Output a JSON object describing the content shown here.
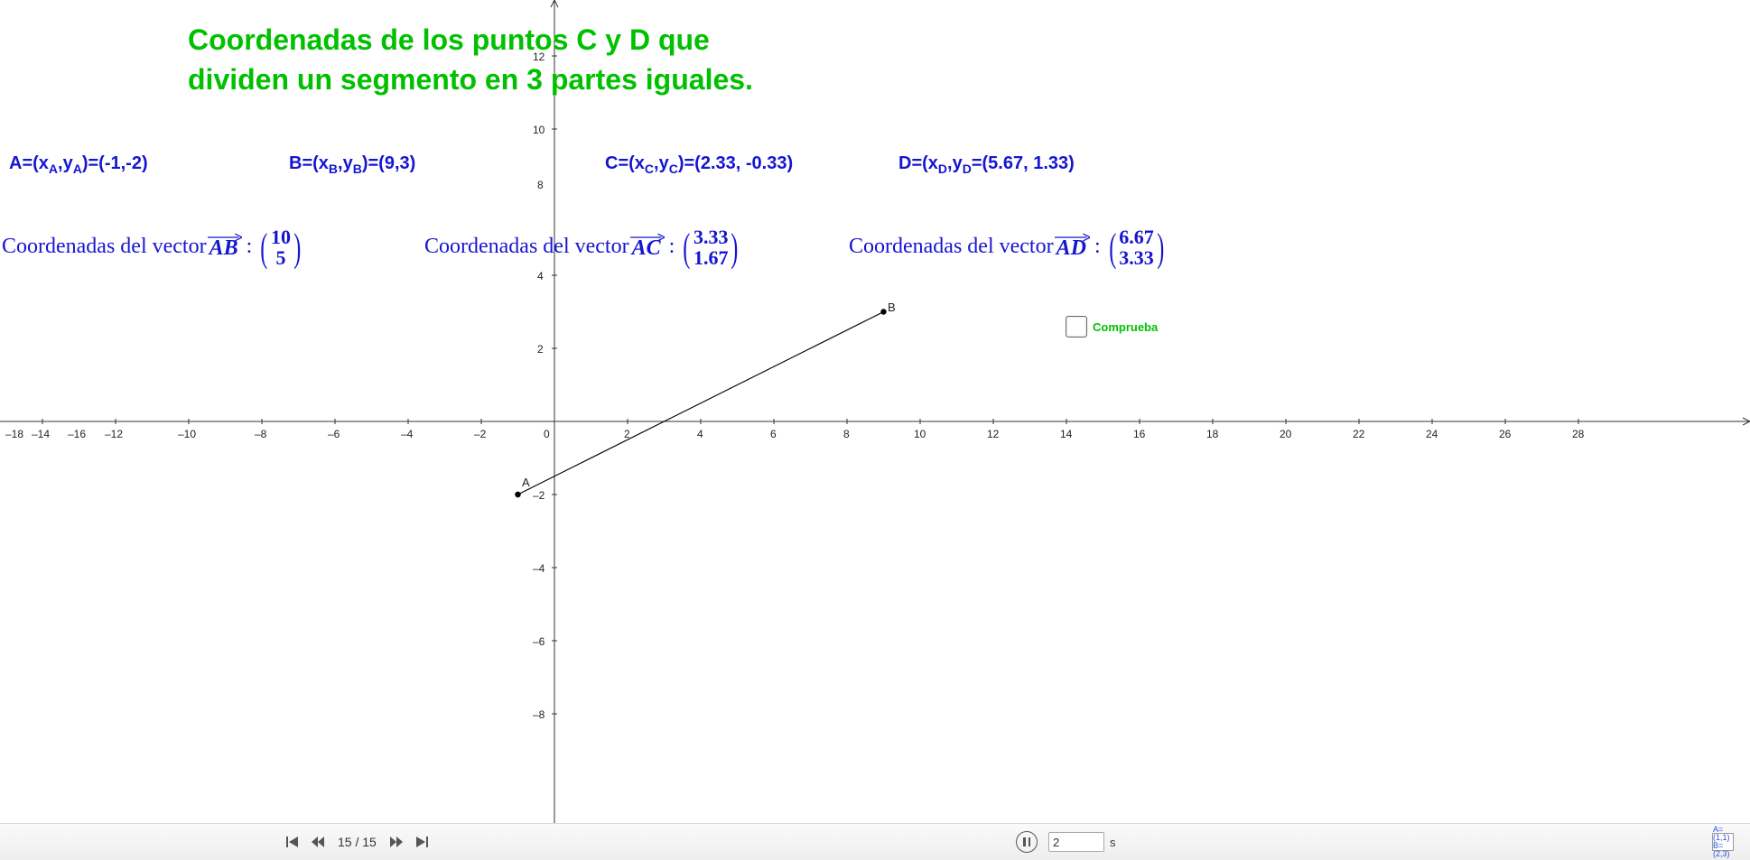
{
  "title_line1": "Coordenadas de los puntos C y D que",
  "title_line2": "dividen un segmento en  3 partes iguales.",
  "points": {
    "A": {
      "sub1": "A",
      "sub2": "A",
      "text": "A=(x",
      "mid": ",y",
      "close": ")=(-1,-2)"
    },
    "B": {
      "sub1": "B",
      "sub2": "B",
      "text": "B=(x",
      "mid": ",y",
      "close": ")=(9,3)"
    },
    "C": {
      "sub1": "C",
      "sub2": "C",
      "text": "C=(x",
      "mid": ",y",
      "close": ")=(2.33, -0.33)"
    },
    "D": {
      "sub1": "D",
      "sub2": "D",
      "text": "D=(x",
      "mid": ",y",
      "close": "=(5.67, 1.33)"
    }
  },
  "vec_prefix": "Coordenadas del vector",
  "vectors": {
    "AB": {
      "name": "AB",
      "x": "10",
      "y": "5"
    },
    "AC": {
      "name": "AC",
      "x": "3.33",
      "y": "1.67"
    },
    "AD": {
      "name": "AD",
      "x": "6.67",
      "y": "3.33"
    }
  },
  "checkbox_label": "Comprueba",
  "toolbar": {
    "counter": "15 / 15",
    "speed_value": "2",
    "speed_unit": "s",
    "aux_top": "A=(1,1)",
    "aux_bot": "B=(2,3)"
  },
  "chart_data": {
    "type": "line",
    "xlabel": "",
    "ylabel": "",
    "xlim": [
      -18,
      28
    ],
    "ylim": [
      -8,
      12
    ],
    "x_ticks": [
      -18,
      -16,
      -14,
      -12,
      -10,
      -8,
      -6,
      -4,
      -2,
      0,
      2,
      4,
      6,
      8,
      10,
      12,
      14,
      16,
      18,
      20,
      22,
      24,
      26,
      28
    ],
    "y_ticks": [
      -8,
      -6,
      -4,
      -2,
      2,
      4,
      8,
      10,
      12
    ],
    "points": [
      {
        "name": "A",
        "x": -1,
        "y": -2
      },
      {
        "name": "B",
        "x": 9,
        "y": 3
      }
    ],
    "segments": [
      {
        "from": "A",
        "to": "B"
      }
    ]
  }
}
